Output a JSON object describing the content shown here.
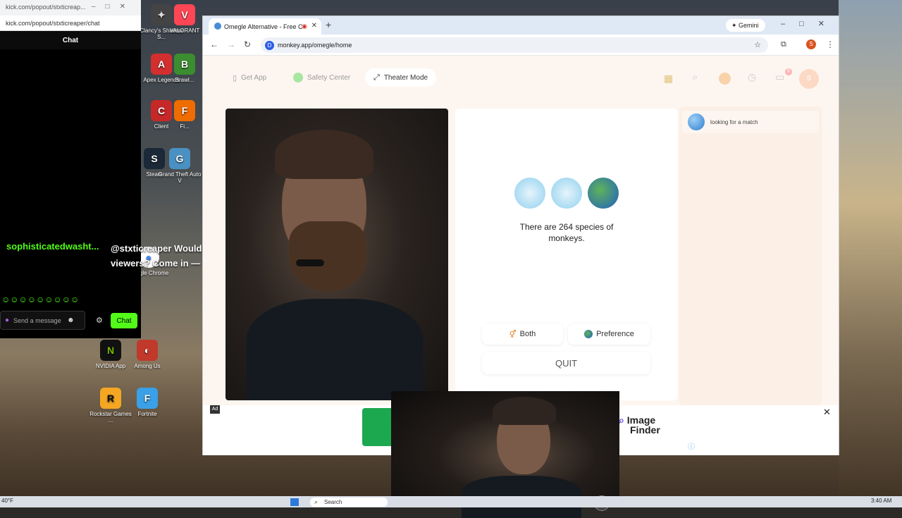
{
  "kick": {
    "url": "kick.com/popout/stxticreaper/chat",
    "url_short": "kick.com/popout/stxticreap...",
    "header": "Chat",
    "username": "sophisticatedwasht...",
    "message_line1": "@stxticreaper Would you like many",
    "message_line2": "viewers? Come in — botsister.com",
    "send_placeholder": "Send a message",
    "chat_button": "Chat"
  },
  "desktop_icons": [
    {
      "label": "Clancy's Shadow S...",
      "icon": "game-icon"
    },
    {
      "label": "VALORANT",
      "icon": "valorant-icon"
    },
    {
      "label": "Apex Legends",
      "icon": "apex-icon"
    },
    {
      "label": "Brawl...",
      "icon": "brawl-icon"
    },
    {
      "label": "Client",
      "icon": "client-icon"
    },
    {
      "label": "Fi...",
      "icon": "app-icon"
    },
    {
      "label": "Steam",
      "icon": "steam-icon"
    },
    {
      "label": "Grand Theft Auto V",
      "icon": "gta-icon"
    },
    {
      "label": "Google Chrome",
      "icon": "chrome-icon"
    },
    {
      "label": "NVIDIA App",
      "icon": "nvidia-icon"
    },
    {
      "label": "Among Us",
      "icon": "amongus-icon"
    },
    {
      "label": "Rockstar Games ...",
      "icon": "rockstar-icon"
    },
    {
      "label": "Fortnite",
      "icon": "fortnite-icon"
    }
  ],
  "browser": {
    "tab_title": "Omegle Alternative - Free C",
    "address": "monkey.app/omegle/home",
    "gemini_label": "Gemini",
    "profile_letter": "S"
  },
  "nav": {
    "get_app": "Get App",
    "safety_center": "Safety Center",
    "theater_mode": "Theater Mode",
    "notif_count": "8"
  },
  "center": {
    "fact": "There are 264 species of monkeys.",
    "both": "Both",
    "preference": "Preference",
    "quit": "QUIT"
  },
  "match": {
    "status": "looking for a match"
  },
  "ad": {
    "badge": "Ad",
    "brand_line1": "Image",
    "brand_line2": "Finder"
  },
  "taskbar": {
    "weather": "40°F",
    "search": "Search",
    "time": "3:40 AM"
  },
  "colors": {
    "kick_green": "#53fc18",
    "page_bg": "#fdf6f0",
    "accent_orange": "#f5a623"
  }
}
